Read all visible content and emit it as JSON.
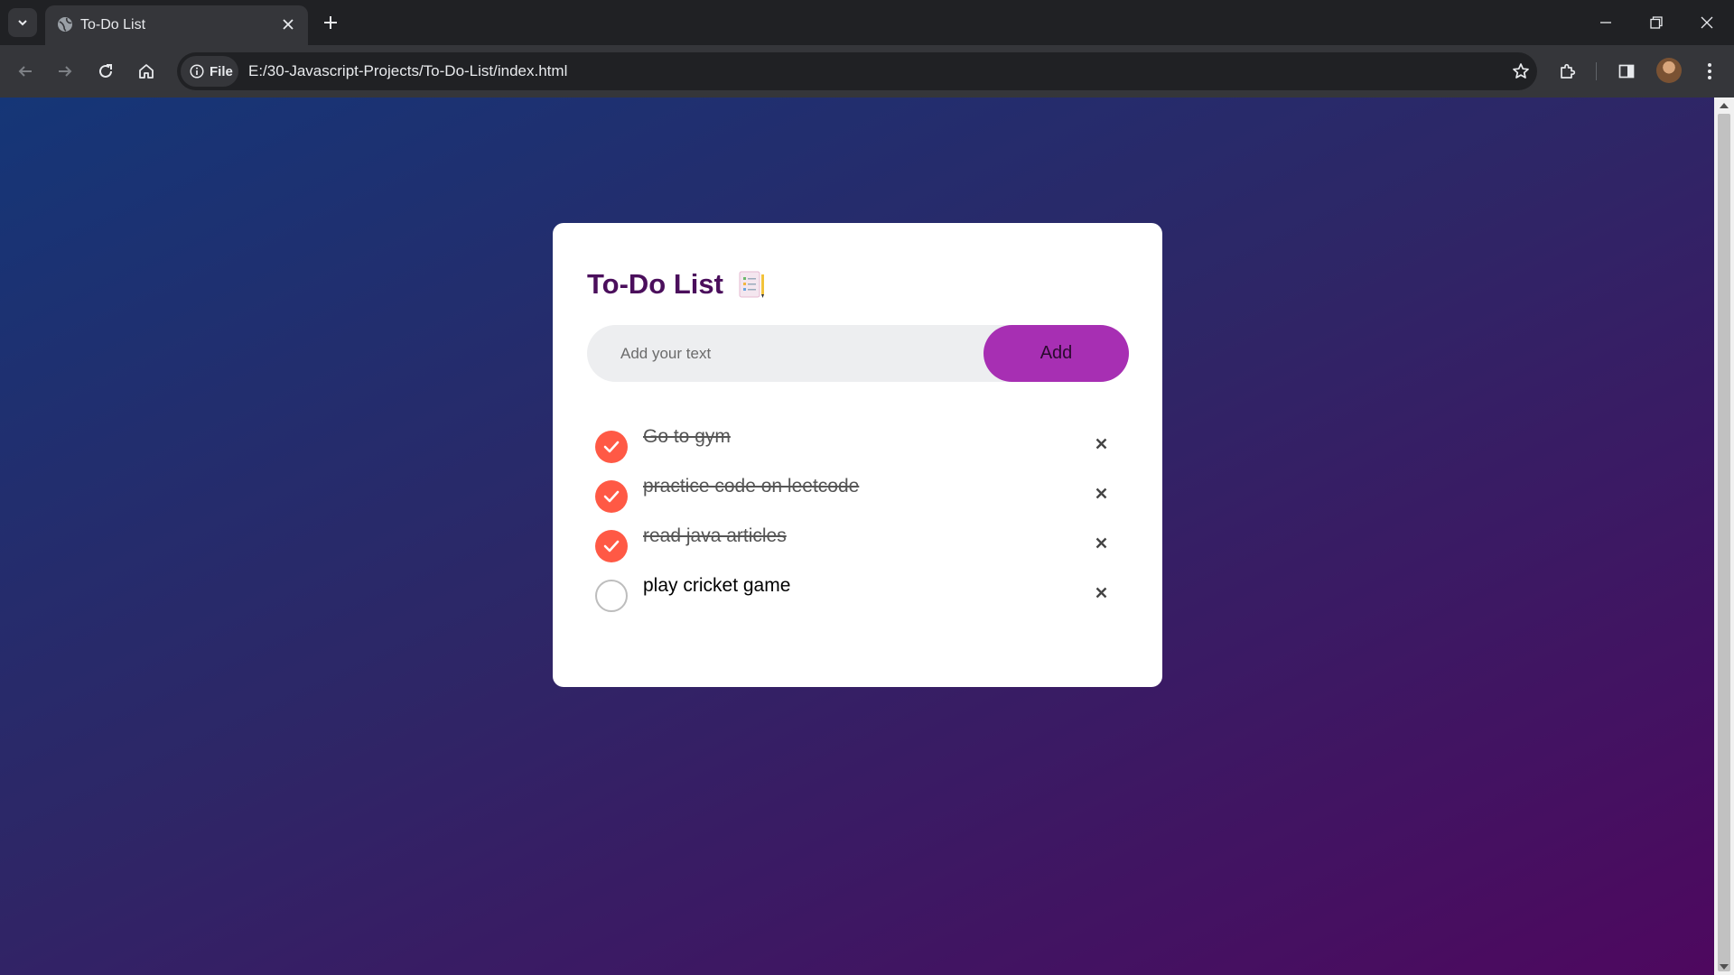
{
  "browser": {
    "tab_title": "To-Do List",
    "site_chip_label": "File",
    "url": "E:/30-Javascript-Projects/To-Do-List/index.html"
  },
  "app": {
    "title": "To-Do List",
    "title_icon": "notepad-icon",
    "input_placeholder": "Add your text",
    "input_value": "",
    "add_button_label": "Add",
    "tasks": [
      {
        "text": "Go to gym",
        "done": true
      },
      {
        "text": "practice code on leetcode",
        "done": true
      },
      {
        "text": "read java articles",
        "done": true
      },
      {
        "text": "play cricket game",
        "done": false
      }
    ]
  },
  "colors": {
    "background_start": "#153677",
    "background_end": "#4e085f",
    "title": "#4b0f5c",
    "add_button": "#a72fb3",
    "check_done": "#ff5945"
  }
}
